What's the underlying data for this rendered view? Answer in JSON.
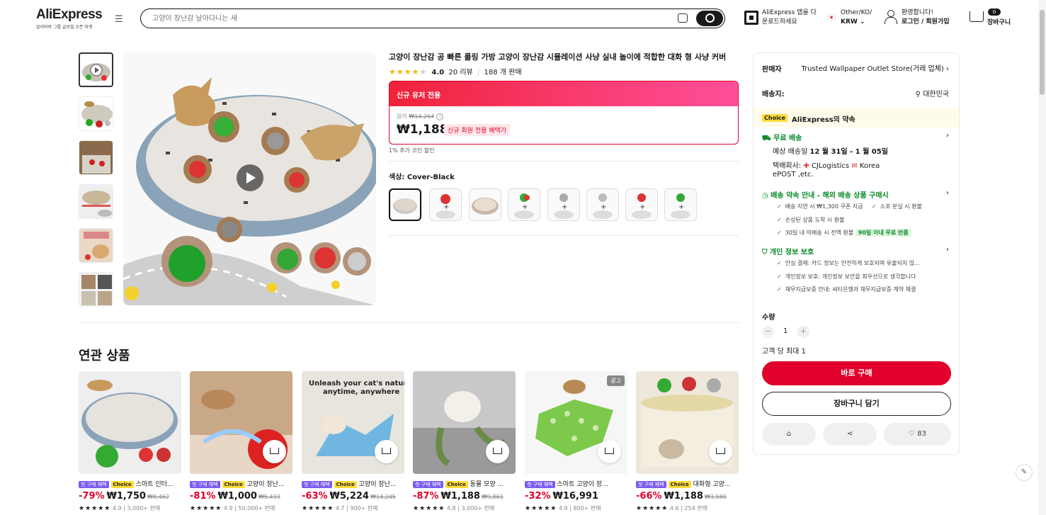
{
  "header": {
    "logo_text": "AliExpress",
    "logo_sub": "알리바바 그룹 글로벌 오픈 마켓",
    "search_placeholder": "고양이 장난감 날아다니는 새",
    "app_line1": "AliExpress 앱을 다",
    "app_line2": "운로드하세요",
    "region_line1": "Other/KO/",
    "region_line2": "KRW",
    "user_line1": "환영합니다!",
    "user_line2": "로그인 / 회원가입",
    "cart_count": "0",
    "cart_label": "장바구니"
  },
  "product": {
    "title": "고양이 장난감 공 빠른 롤링 가방 고양이 장난감 시뮬레이션 사냥 실내 놀이에 적합한 대화 형 사냥 커버",
    "rating": "4.0",
    "reviews": "20 리뷰",
    "sold": "188 개 판매",
    "new_user_label": "신규 유저 전용",
    "orig_label": "원가",
    "orig_price": "₩14,264",
    "price": "₩1,188",
    "price_badge": "신규 회원 전용 혜택가",
    "coin_note": "1% 추가 코인 할인",
    "color_label": "색상: Cover-Black"
  },
  "related": {
    "title": "연관 상품",
    "items": [
      {
        "tag1": "첫 구매 혜택",
        "tag2": "Choice",
        "name": "스마트 인터...",
        "pct": "-79%",
        "price": "₩1,750",
        "orig": "₩8,462",
        "rating_text": "4.9 | 3,000+ 판매",
        "ad": ""
      },
      {
        "tag1": "첫 구매 혜택",
        "tag2": "Choice",
        "name": "고양이 장난...",
        "pct": "-81%",
        "price": "₩1,000",
        "orig": "₩5,433",
        "rating_text": "4.9 | 50,000+ 판매",
        "ad": ""
      },
      {
        "tag1": "첫 구매 혜택",
        "tag2": "Choice",
        "name": "고양이 장난...",
        "pct": "-63%",
        "price": "₩5,224",
        "orig": "₩14,245",
        "rating_text": "4.7 | 900+ 판매",
        "ad": ""
      },
      {
        "tag1": "첫 구매 혜택",
        "tag2": "Choice",
        "name": "동물 모양 ...",
        "pct": "-87%",
        "price": "₩1,188",
        "orig": "₩9,861",
        "rating_text": "4.8 | 3,000+ 판매",
        "ad": ""
      },
      {
        "tag1": "첫 구매 혜택",
        "tag2": "",
        "name": "스마트 고양이 장...",
        "pct": "-32%",
        "price": "₩16,991",
        "orig": "",
        "rating_text": "4.9 | 800+ 판매",
        "ad": "광고"
      },
      {
        "tag1": "첫 구매 혜택",
        "tag2": "Choice",
        "name": "대화형 고양...",
        "pct": "-66%",
        "price": "₩1,188",
        "orig": "₩3,580",
        "rating_text": "4.6 | 254 판매",
        "ad": ""
      }
    ]
  },
  "sidebar": {
    "seller_label": "판매자",
    "seller_name": "Trusted Wallpaper Outlet Store(거래 업체)",
    "ship_label": "배송지:",
    "ship_value": "대한민국",
    "choice_badge": "Choice",
    "choice_title": "AliExpress의 약속",
    "free_ship": "무료 배송",
    "eta_prefix": "예상 배송일",
    "eta_dates": "12 월 31일 - 1 월 05일",
    "courier_line1": "택배회사:",
    "courier_line1b": "CJLogistics",
    "courier_line1c": "Korea",
    "courier_line2": "ePOST ,etc.",
    "promise_title": "배송 약속 안내 - 해외 배송 상품 구매시",
    "promise_items": [
      "배송 지연 시 ₩1,300 쿠폰 지급",
      "소포 분실 시 환불",
      "손상된 상품 도착 시 환불",
      "30일 내 미배송 시 전액 환불"
    ],
    "promise_badge": "90일 이내 무료 반품",
    "privacy_title": "개인 정보 보호",
    "privacy_items": [
      "안심 결제: 카드 정보는 안전하게 보호되며 유출되지 않...",
      "개인정보 보호: 개인정보 보안을 최우선으로 생각합니다",
      "채무지급보증 안내: 씨티은행과 채무지급보증 계약 체결"
    ],
    "qty_label": "수량",
    "qty_value": "1",
    "max_note": "고객 당 최대 1",
    "buy_now": "바로 구매",
    "add_cart": "장바구니 담기",
    "wish_count": "83"
  }
}
